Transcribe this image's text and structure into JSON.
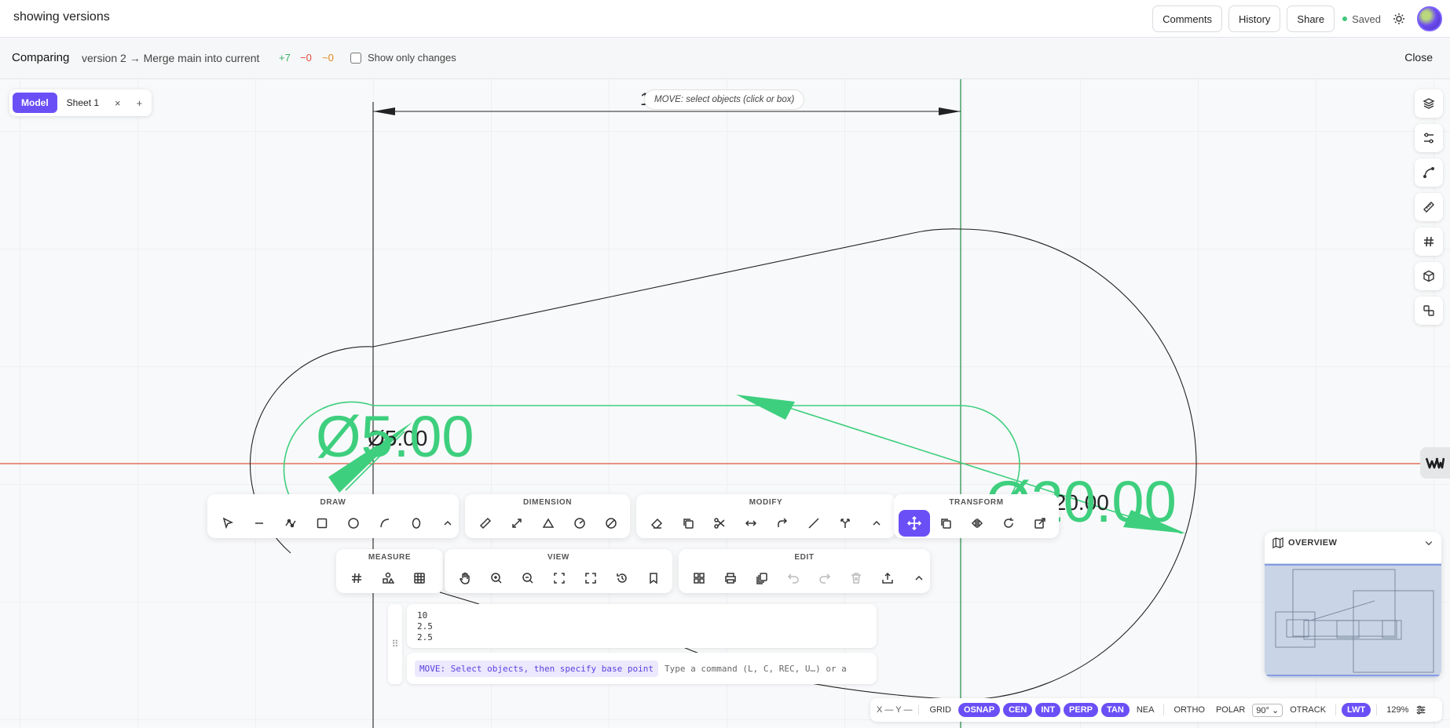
{
  "topbar": {
    "title": "showing versions",
    "comments_label": "Comments",
    "history_label": "History",
    "share_label": "Share",
    "saved_label": "Saved"
  },
  "compare": {
    "label": "Comparing",
    "version_text": "version 2 → Merge main into current",
    "added": "+7",
    "removed": "−0",
    "modified": "~0",
    "show_only_changes": "Show only changes",
    "close_label": "Close"
  },
  "sheets": {
    "model_label": "Model",
    "sheet_label": "Sheet 1",
    "close_glyph": "×",
    "add_glyph": "+"
  },
  "hint": "MOVE: select objects (click or box)",
  "drawing": {
    "dim_left_overlay": "Ø5.00",
    "dim_left_base": "Ø5.00",
    "dim_right_overlay": "Ø20.00",
    "dim_right_base": "Ø20.00",
    "top_dim_fragment": "1"
  },
  "toolbars": [
    {
      "title": "DRAW",
      "tools": [
        "select-icon",
        "line-icon",
        "polyline-icon",
        "rectangle-icon",
        "circle-icon",
        "arc-icon",
        "ellipse-icon",
        "chevron-up-icon"
      ]
    },
    {
      "title": "DIMENSION",
      "tools": [
        "ruler-icon",
        "aligned-dim-icon",
        "angle-dim-icon",
        "radius-dim-icon",
        "diameter-dim-icon"
      ]
    },
    {
      "title": "MODIFY",
      "tools": [
        "eraser-icon",
        "copy-icon",
        "scissors-icon",
        "stretch-icon",
        "offset-icon",
        "line-slash-icon",
        "extend-icon",
        "chevron-up-icon"
      ]
    },
    {
      "title": "TRANSFORM",
      "tools": [
        "move-icon",
        "copy-icon",
        "mirror-icon",
        "rotate-icon",
        "scale-icon"
      ]
    },
    {
      "title": "MEASURE",
      "tools": [
        "grid-hash-icon",
        "shapes-icon",
        "table-icon"
      ]
    },
    {
      "title": "VIEW",
      "tools": [
        "pan-hand-icon",
        "zoom-in-icon",
        "zoom-out-icon",
        "zoom-extents-icon",
        "zoom-window-icon",
        "history-icon",
        "bookmark-icon"
      ]
    },
    {
      "title": "EDIT",
      "tools": [
        "grid-icon",
        "print-icon",
        "layers-copy-icon",
        "undo-icon",
        "redo-icon",
        "trash-icon",
        "export-icon",
        "chevron-up-icon"
      ]
    }
  ],
  "command": {
    "history": [
      "10",
      "2.5",
      "2.5"
    ],
    "prompt": "MOVE: Select objects, then specify base point",
    "placeholder": "Type a command (L, C, REC, U…) or a"
  },
  "overview": {
    "title": "OVERVIEW"
  },
  "status": {
    "coords": "X — Y —",
    "grid": "GRID",
    "osnap": "OSNAP",
    "cen": "CEN",
    "int": "INT",
    "perp": "PERP",
    "tan": "TAN",
    "nea": "NEA",
    "ortho": "ORTHO",
    "polar": "POLAR",
    "polar_angle": "90°",
    "otrack": "OTRACK",
    "lwt": "LWT",
    "zoom": "129%"
  },
  "colors": {
    "accent": "#6b4ff6",
    "added_green": "#3ecf7e",
    "axis_red": "#e0553f",
    "axis_green": "#3a9a5b"
  }
}
